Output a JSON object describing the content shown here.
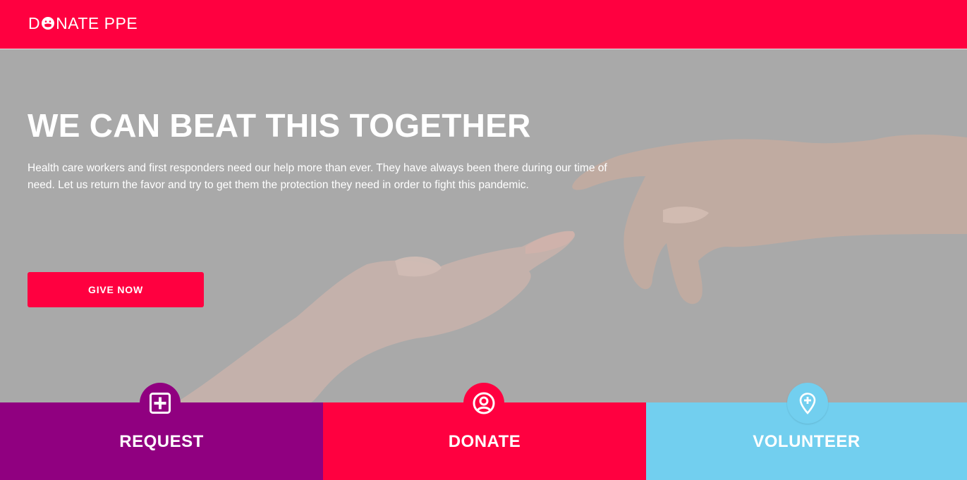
{
  "brand": {
    "logo_before": "D",
    "logo_after": "NATE PPE",
    "logo_mark_icon": "face-mask-icon"
  },
  "hero": {
    "title": "WE CAN BEAT THIS TOGETHER",
    "description": "Health care workers and first responders need our help more than ever. They have always been there during our time of need. Let us return the favor and try to get them the protection they need in order to fight this pandemic.",
    "cta_label": "GIVE NOW",
    "image_subject": "reaching-hands-image"
  },
  "actions": [
    {
      "label": "REQUEST",
      "icon": "plus-square-icon",
      "color": "#900080"
    },
    {
      "label": "DONATE",
      "icon": "user-circle-icon",
      "color": "#ff0040"
    },
    {
      "label": "VOLUNTEER",
      "icon": "map-pin-plus-icon",
      "color": "#72cfef"
    }
  ],
  "colors": {
    "brand": "#ff0040",
    "request": "#900080",
    "donate": "#ff0040",
    "volunteer": "#72cfef"
  }
}
